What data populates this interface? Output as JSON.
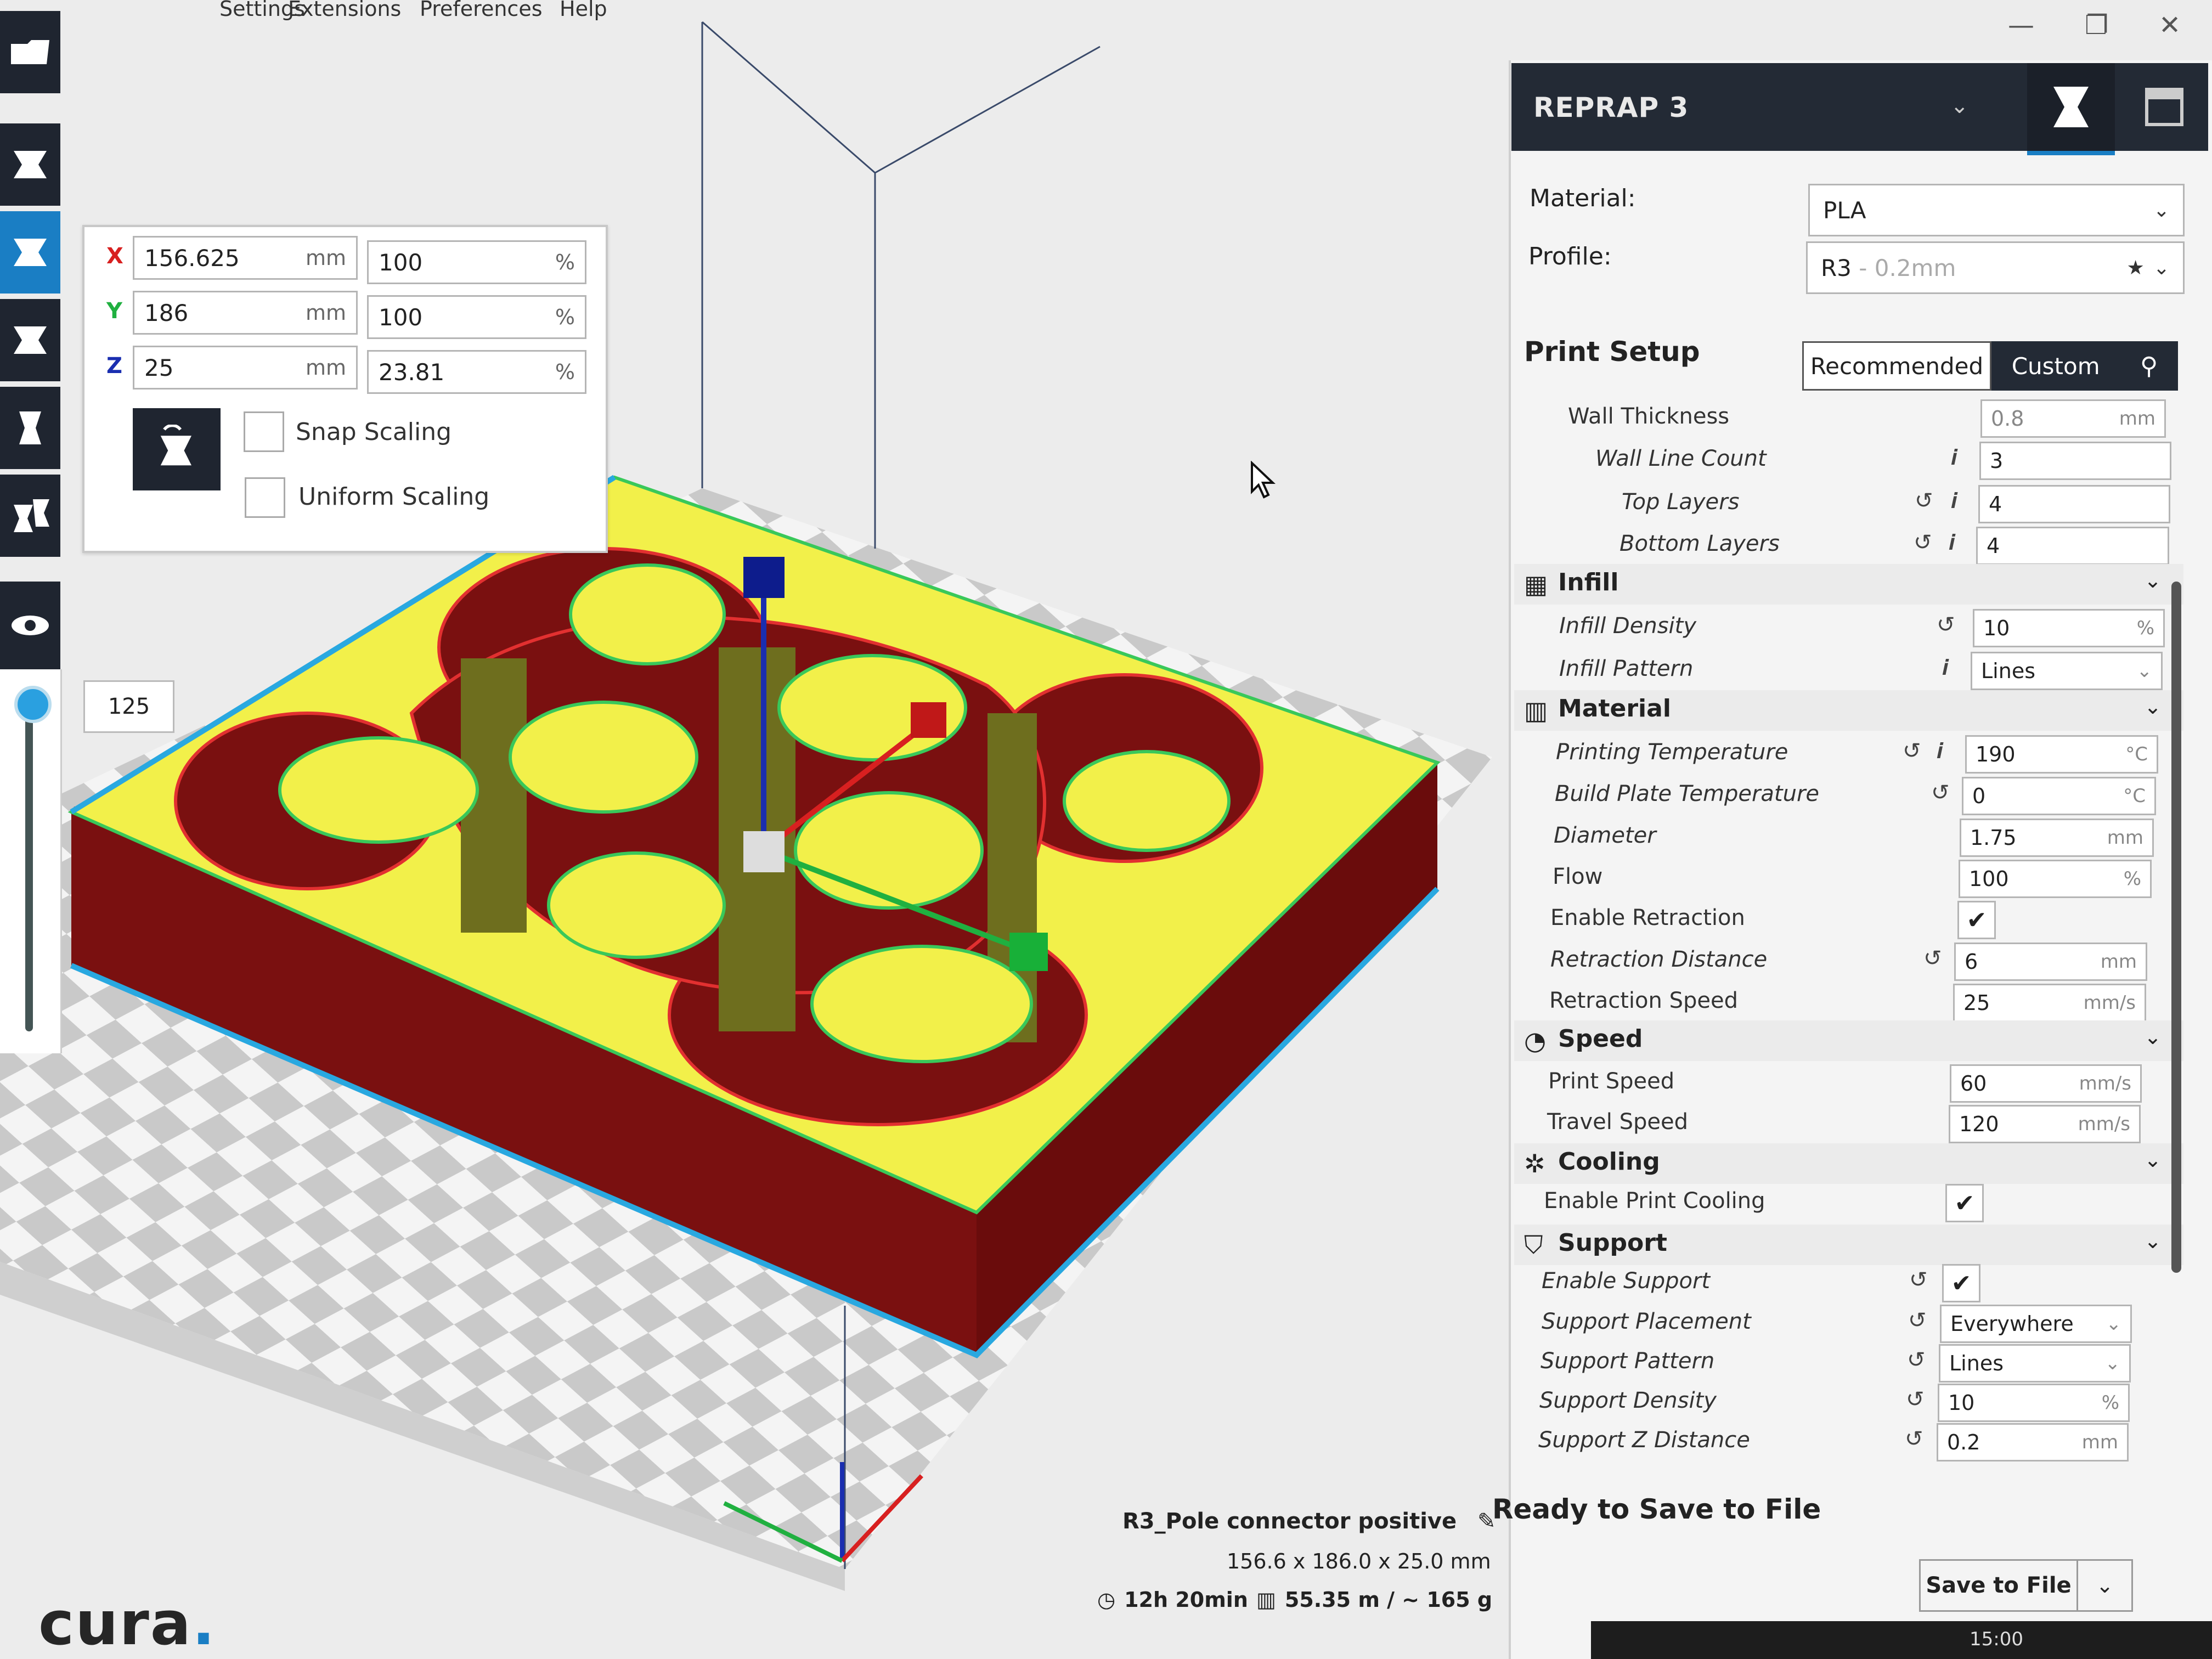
{
  "menu": {
    "items": [
      "Settings",
      "Extensions",
      "Preferences",
      "Help"
    ]
  },
  "window_controls": {
    "minimize": "—",
    "restore": "❐",
    "close": "✕"
  },
  "layer_view": {
    "current_layer": "125"
  },
  "scale_panel": {
    "x": {
      "label": "X",
      "mm": "156.625",
      "mm_unit": "mm",
      "pct": "100",
      "pct_unit": "%"
    },
    "y": {
      "label": "Y",
      "mm": "186",
      "mm_unit": "mm",
      "pct": "100",
      "pct_unit": "%"
    },
    "z": {
      "label": "Z",
      "mm": "25",
      "mm_unit": "mm",
      "pct": "23.81",
      "pct_unit": "%"
    },
    "snap_scaling": "Snap Scaling",
    "uniform_scaling": "Uniform Scaling"
  },
  "printer": {
    "name": "REPRAP 3"
  },
  "material": {
    "label": "Material:",
    "value": "PLA"
  },
  "profile": {
    "label": "Profile:",
    "value": "R3",
    "suffix": " - 0.2mm"
  },
  "print_setup": {
    "title": "Print Setup",
    "recommended": "Recommended",
    "custom": "Custom"
  },
  "settings": {
    "wall_thickness": {
      "label": "Wall Thickness",
      "value": "0.8",
      "unit": "mm"
    },
    "wall_line_count": {
      "label": "Wall Line Count",
      "value": "3"
    },
    "top_layers": {
      "label": "Top Layers",
      "value": "4"
    },
    "bottom_layers": {
      "label": "Bottom Layers",
      "value": "4"
    },
    "infill": {
      "title": "Infill"
    },
    "infill_density": {
      "label": "Infill Density",
      "value": "10",
      "unit": "%"
    },
    "infill_pattern": {
      "label": "Infill Pattern",
      "value": "Lines"
    },
    "material_cat": {
      "title": "Material"
    },
    "printing_temperature": {
      "label": "Printing Temperature",
      "value": "190",
      "unit": "°C"
    },
    "build_plate_temperature": {
      "label": "Build Plate Temperature",
      "value": "0",
      "unit": "°C"
    },
    "diameter": {
      "label": "Diameter",
      "value": "1.75",
      "unit": "mm"
    },
    "flow": {
      "label": "Flow",
      "value": "100",
      "unit": "%"
    },
    "enable_retraction": {
      "label": "Enable Retraction",
      "checked": "✔"
    },
    "retraction_distance": {
      "label": "Retraction Distance",
      "value": "6",
      "unit": "mm"
    },
    "retraction_speed": {
      "label": "Retraction Speed",
      "value": "25",
      "unit": "mm/s"
    },
    "speed": {
      "title": "Speed"
    },
    "print_speed": {
      "label": "Print Speed",
      "value": "60",
      "unit": "mm/s"
    },
    "travel_speed": {
      "label": "Travel Speed",
      "value": "120",
      "unit": "mm/s"
    },
    "cooling": {
      "title": "Cooling"
    },
    "enable_print_cooling": {
      "label": "Enable Print Cooling",
      "checked": "✔"
    },
    "support": {
      "title": "Support"
    },
    "enable_support": {
      "label": "Enable Support",
      "checked": "✔"
    },
    "support_placement": {
      "label": "Support Placement",
      "value": "Everywhere"
    },
    "support_pattern": {
      "label": "Support Pattern",
      "value": "Lines"
    },
    "support_density": {
      "label": "Support Density",
      "value": "10",
      "unit": "%"
    },
    "support_z_distance": {
      "label": "Support Z Distance",
      "value": "0.2",
      "unit": "mm"
    }
  },
  "output": {
    "ready": "Ready to Save to File",
    "save_button": "Save to File",
    "job_name": "R3_Pole connector positive",
    "dimensions": "156.6 x 186.0 x 25.0 mm",
    "print_time": "12h 20min",
    "material_usage": "55.35 m / ~ 165 g"
  },
  "branding": {
    "logo": "cura",
    "logo_dot": "."
  },
  "clock": "15:00",
  "colors": {
    "accent": "#1a7ec4",
    "dark_panel": "#232a35",
    "model_top": "#f2f04a",
    "model_wall": "#7a1010",
    "model_inner": "#6e6e1e"
  }
}
